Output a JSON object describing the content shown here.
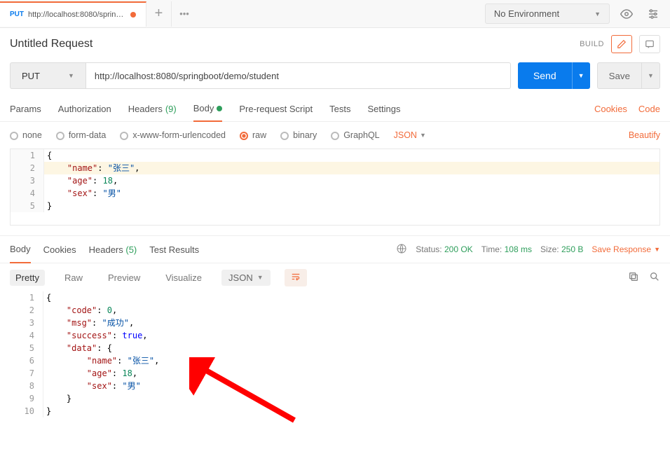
{
  "topbar": {
    "tab_method": "PUT",
    "tab_title": "http://localhost:8080/springbo...",
    "environment": "No Environment"
  },
  "request": {
    "name": "Untitled Request",
    "build": "BUILD",
    "method": "PUT",
    "url": "http://localhost:8080/springboot/demo/student",
    "send": "Send",
    "save": "Save"
  },
  "tabs": {
    "params": "Params",
    "auth": "Authorization",
    "headers": "Headers",
    "headers_count": "(9)",
    "body": "Body",
    "prerequest": "Pre-request Script",
    "tests": "Tests",
    "settings": "Settings",
    "cookies": "Cookies",
    "code": "Code"
  },
  "bodytype": {
    "none": "none",
    "formdata": "form-data",
    "url": "x-www-form-urlencoded",
    "raw": "raw",
    "binary": "binary",
    "graphql": "GraphQL",
    "json": "JSON",
    "beautify": "Beautify"
  },
  "req_body": {
    "l1": "{",
    "l2_k": "\"name\"",
    "l2_v": "\"张三\"",
    "l3_k": "\"age\"",
    "l3_v": "18",
    "l4_k": "\"sex\"",
    "l4_v": "\"男\"",
    "l5": "}"
  },
  "resp_tabs": {
    "body": "Body",
    "cookies": "Cookies",
    "headers": "Headers",
    "headers_count": "(5)",
    "tests": "Test Results"
  },
  "status": {
    "status_lbl": "Status:",
    "status_val": "200 OK",
    "time_lbl": "Time:",
    "time_val": "108 ms",
    "size_lbl": "Size:",
    "size_val": "250 B",
    "save_resp": "Save Response"
  },
  "viewbar": {
    "pretty": "Pretty",
    "raw": "Raw",
    "preview": "Preview",
    "visualize": "Visualize",
    "json": "JSON"
  },
  "resp_body": {
    "l1": "{",
    "l2_k": "\"code\"",
    "l2_v": "0",
    "l3_k": "\"msg\"",
    "l3_v": "\"成功\"",
    "l4_k": "\"success\"",
    "l4_v": "true",
    "l5_k": "\"data\"",
    "l5_v": "{",
    "l6_k": "\"name\"",
    "l6_v": "\"张三\"",
    "l7_k": "\"age\"",
    "l7_v": "18",
    "l8_k": "\"sex\"",
    "l8_v": "\"男\"",
    "l9": "}",
    "l10": "}"
  }
}
